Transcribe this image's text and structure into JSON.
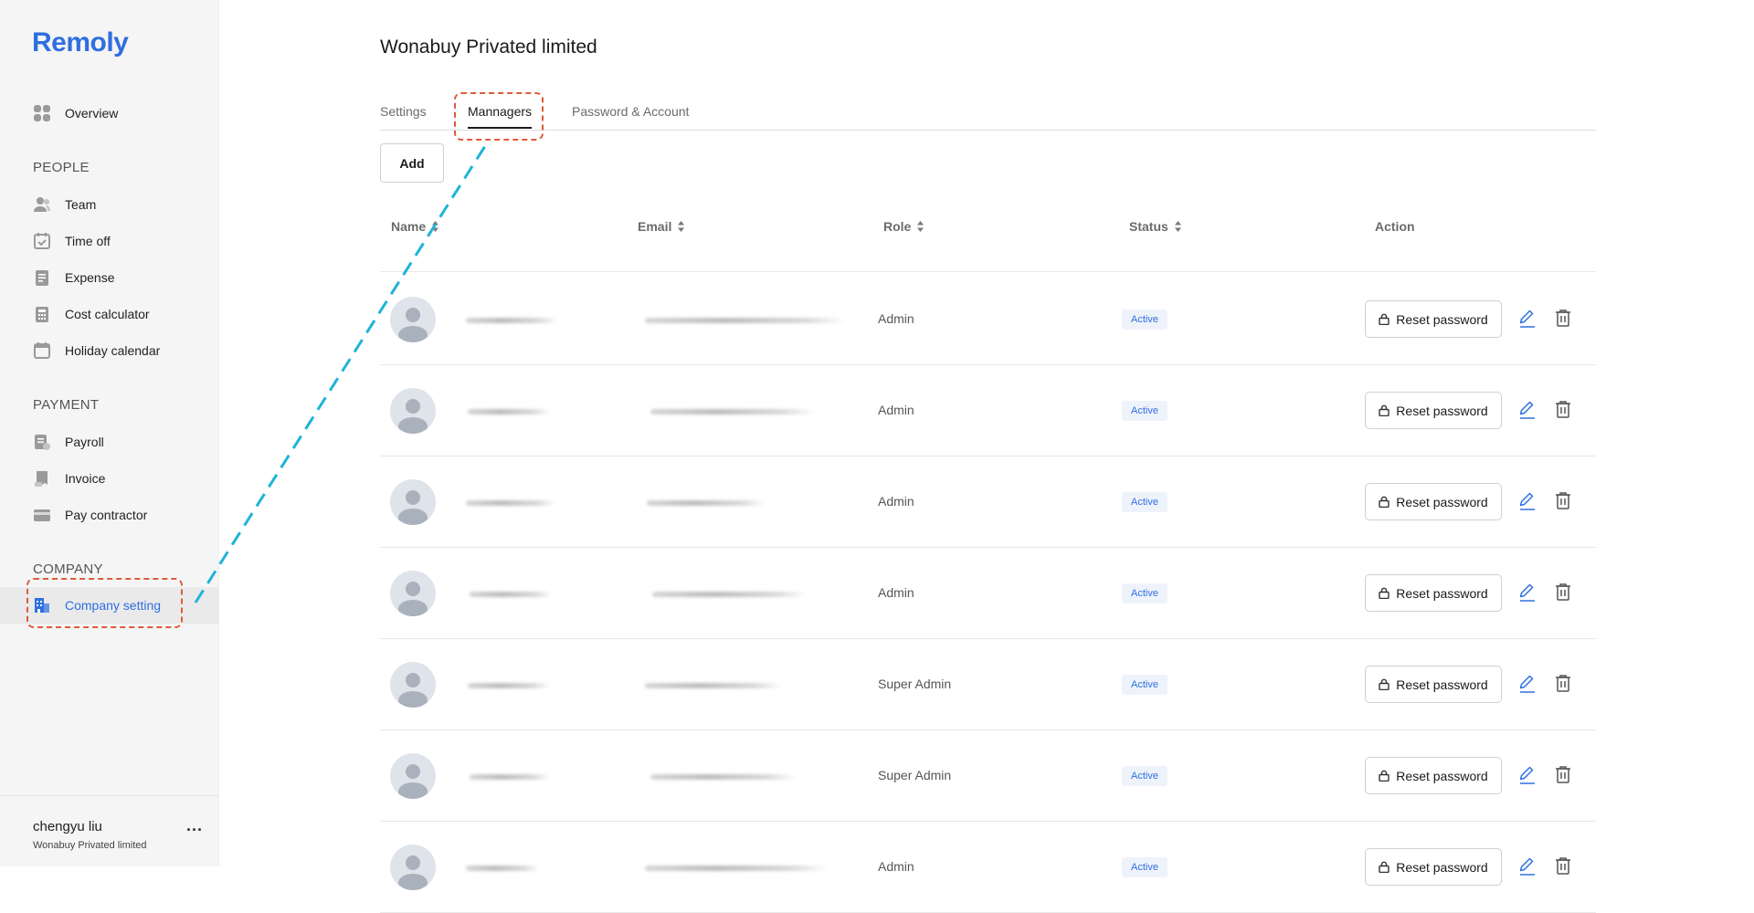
{
  "sidebar": {
    "logo": "Remoly",
    "overview": "Overview",
    "sections": {
      "people": "PEOPLE",
      "payment": "PAYMENT",
      "company": "COMPANY"
    },
    "people_items": [
      "Team",
      "Time off",
      "Expense",
      "Cost calculator",
      "Holiday calendar"
    ],
    "payment_items": [
      "Payroll",
      "Invoice",
      "Pay contractor"
    ],
    "company_items": [
      "Company setting"
    ],
    "user": {
      "name": "chengyu liu",
      "company": "Wonabuy Privated limited",
      "menu": "..."
    },
    "accent": "#2f6fe0"
  },
  "main": {
    "title": "Wonabuy Privated limited",
    "tabs": [
      "Settings",
      "Mannagers",
      "Password & Account"
    ],
    "active_tab": "Mannagers",
    "add_button": "Add",
    "table": {
      "headers": [
        "Name",
        "Email",
        "Role",
        "Status",
        "Action"
      ],
      "rows": [
        {
          "role": "Admin",
          "status": "Active",
          "action": "Reset password"
        },
        {
          "role": "Admin",
          "status": "Active",
          "action": "Reset password"
        },
        {
          "role": "Admin",
          "status": "Active",
          "action": "Reset password"
        },
        {
          "role": "Admin",
          "status": "Active",
          "action": "Reset password"
        },
        {
          "role": "Super Admin",
          "status": "Active",
          "action": "Reset password"
        },
        {
          "role": "Super Admin",
          "status": "Active",
          "action": "Reset password"
        },
        {
          "role": "Admin",
          "status": "Active",
          "action": "Reset password"
        }
      ]
    }
  },
  "annotation": {
    "box_color": "#e05a3a",
    "line_color": "#1fb3d9"
  }
}
